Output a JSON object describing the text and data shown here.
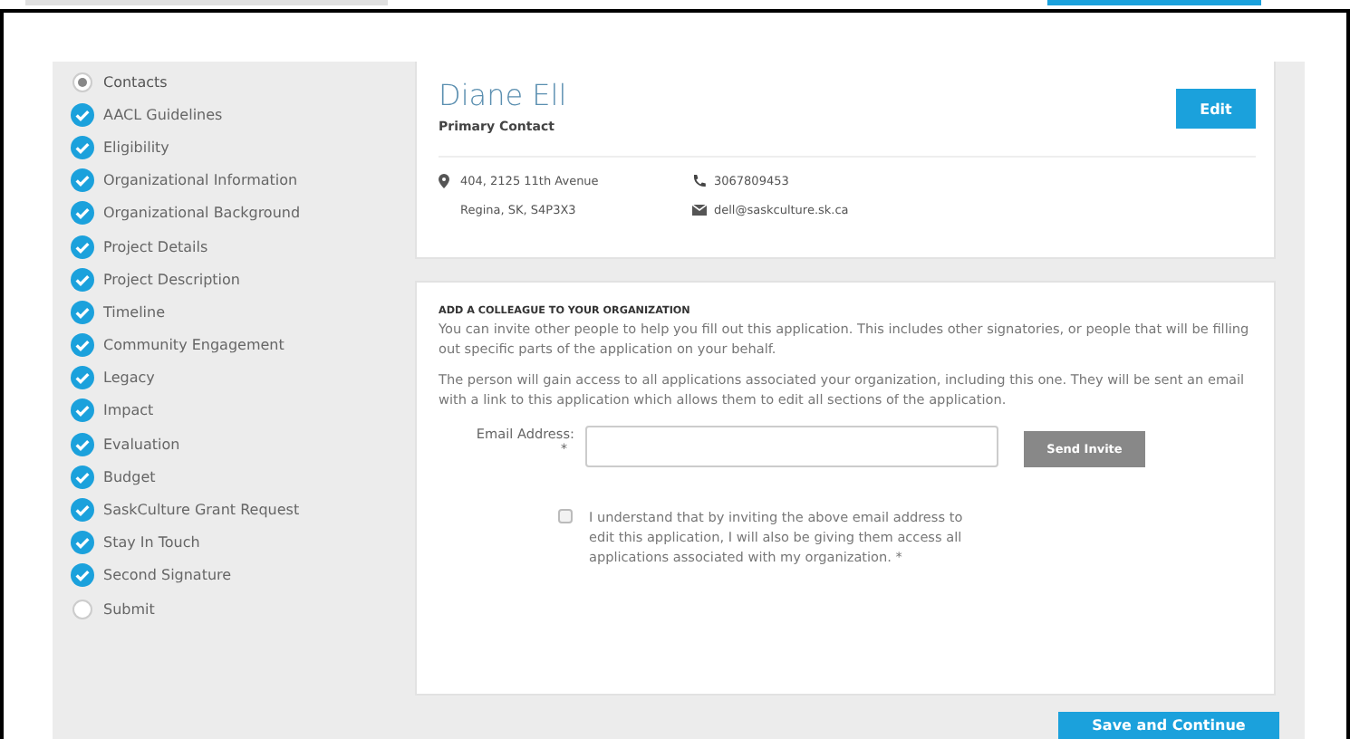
{
  "sidebar": {
    "items": [
      {
        "label": "Contacts",
        "selected": true,
        "completed": false
      },
      {
        "label": "AACL Guidelines",
        "selected": false,
        "completed": true
      },
      {
        "label": "Eligibility",
        "selected": false,
        "completed": true
      },
      {
        "label": "Organizational Information",
        "selected": false,
        "completed": true
      },
      {
        "label": "Organizational Background",
        "selected": false,
        "completed": true
      },
      {
        "label": "Project Details",
        "selected": false,
        "completed": true
      },
      {
        "label": "Project Description",
        "selected": false,
        "completed": true
      },
      {
        "label": "Timeline",
        "selected": false,
        "completed": true
      },
      {
        "label": "Community Engagement",
        "selected": false,
        "completed": true
      },
      {
        "label": "Legacy",
        "selected": false,
        "completed": true
      },
      {
        "label": "Impact",
        "selected": false,
        "completed": true
      },
      {
        "label": "Evaluation",
        "selected": false,
        "completed": true
      },
      {
        "label": "Budget",
        "selected": false,
        "completed": true
      },
      {
        "label": "SaskCulture Grant Request",
        "selected": false,
        "completed": true
      },
      {
        "label": "Stay In Touch",
        "selected": false,
        "completed": true
      },
      {
        "label": "Second Signature",
        "selected": false,
        "completed": true
      },
      {
        "label": "Submit",
        "selected": false,
        "completed": false
      }
    ]
  },
  "contact": {
    "name": "Diane Ell",
    "role": "Primary Contact",
    "edit_button": "Edit",
    "address": [
      "404, 2125 11th Avenue",
      "Regina, SK, S4P3X3"
    ],
    "phone": "3067809453",
    "email": "dell@saskculture.sk.ca"
  },
  "invite": {
    "heading": "ADD A COLLEAGUE TO YOUR ORGANIZATION",
    "paragraphs": [
      "You can invite other people to help you fill out this application. This includes other signatories, or people that will be filling out specific parts of the application on your behalf.",
      "The person will gain access to all applications associated your organization, including this one. They will be sent an email with a link to this application which allows them to edit all sections of the application."
    ],
    "email_label": "Email Address:",
    "required_mark": "*",
    "send_button": "Send Invite",
    "consent": {
      "checked": false,
      "text": "I understand that by inviting the above email address to edit this application, I will also be giving them access all applications associated with my organization.",
      "required_mark": "*"
    }
  },
  "save_button": "Save and Continue"
}
